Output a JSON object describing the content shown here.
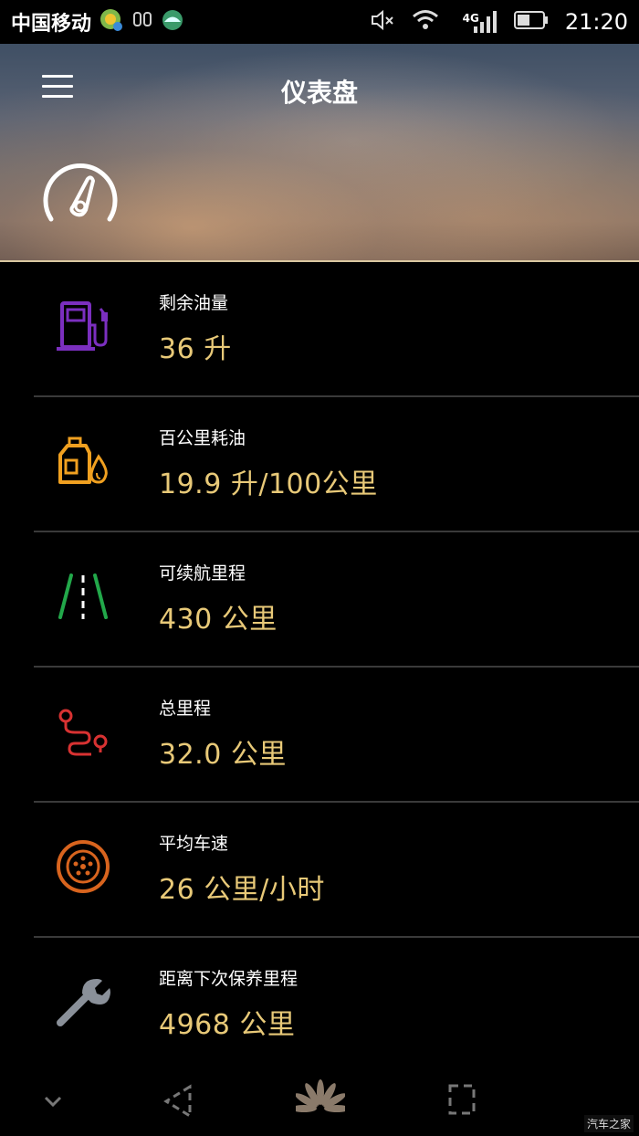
{
  "status_bar": {
    "carrier": "中国移动",
    "network": "4G",
    "time": "21:20"
  },
  "header": {
    "title": "仪表盘"
  },
  "items": [
    {
      "label": "剩余油量",
      "value": "36 升",
      "icon": "fuel-pump-icon",
      "color": "#7b2fbf"
    },
    {
      "label": "百公里耗油",
      "value": "19.9 升/100公里",
      "icon": "oil-can-icon",
      "color": "#f0a020"
    },
    {
      "label": "可续航里程",
      "value": "430 公里",
      "icon": "road-icon",
      "color": "#22a84a"
    },
    {
      "label": "总里程",
      "value": "32.0 公里",
      "icon": "route-icon",
      "color": "#d83232"
    },
    {
      "label": "平均车速",
      "value": "26 公里/小时",
      "icon": "wheel-icon",
      "color": "#d8641e"
    },
    {
      "label": "距离下次保养里程",
      "value": "4968 公里",
      "icon": "wrench-icon",
      "color": "#8a9099"
    }
  ],
  "value_color": "#e8c978",
  "watermark": "汽车之家"
}
